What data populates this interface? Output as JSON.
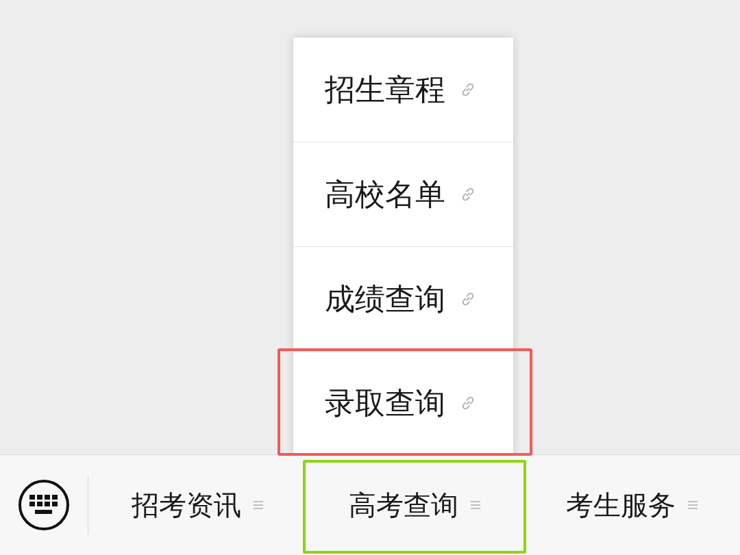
{
  "popup_menu": {
    "items": [
      {
        "label": "招生章程",
        "highlighted": false
      },
      {
        "label": "高校名单",
        "highlighted": false
      },
      {
        "label": "成绩查询",
        "highlighted": false
      },
      {
        "label": "录取查询",
        "highlighted": true
      }
    ]
  },
  "menu_bar": {
    "tabs": [
      {
        "label": "招考资讯",
        "highlighted": false
      },
      {
        "label": "高考查询",
        "highlighted": true
      },
      {
        "label": "考生服务",
        "highlighted": false
      }
    ]
  }
}
